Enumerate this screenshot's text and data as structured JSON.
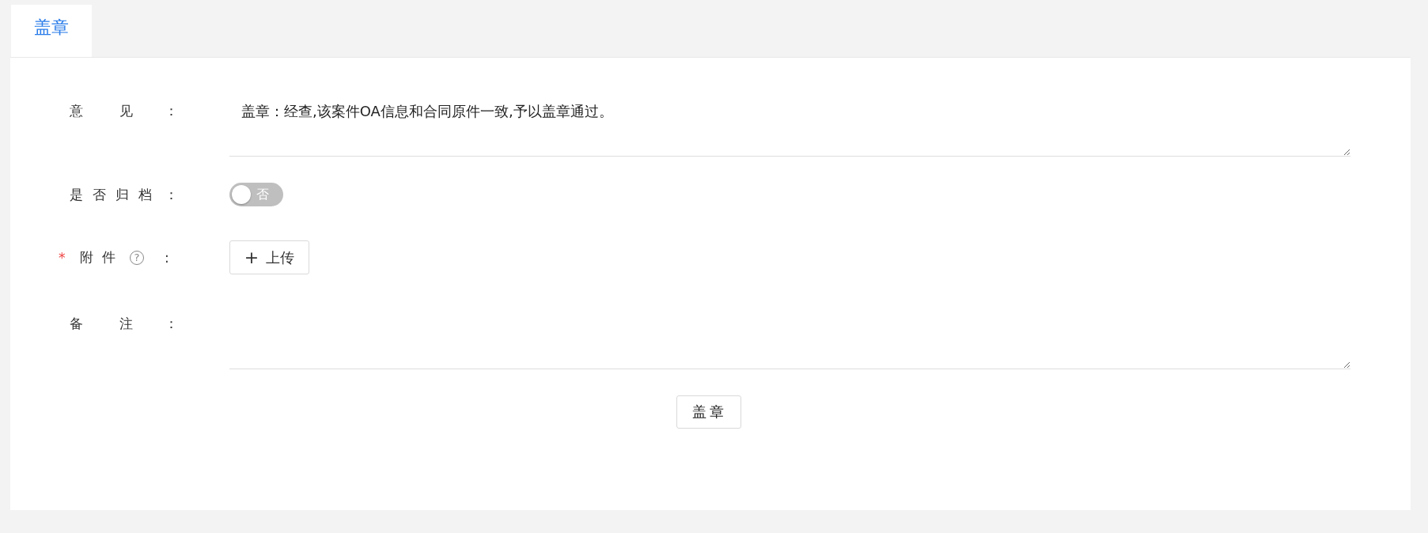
{
  "tabs": [
    {
      "label": "盖章",
      "selected": true
    }
  ],
  "form": {
    "rows": [
      {
        "kind": "textarea",
        "label": "意见",
        "colon": "：",
        "value": "盖章：经查,该案件OA信息和合同原件一致,予以盖章通过。"
      },
      {
        "kind": "switch",
        "label": "是否归档",
        "colon": "：",
        "on": false,
        "off_text": "否"
      },
      {
        "kind": "upload",
        "label": "附件",
        "colon": ":",
        "required_mark": "*",
        "help_icon": "?",
        "button": "上传",
        "button_icon": "+"
      },
      {
        "kind": "textarea",
        "label": "备注",
        "colon": "："
      }
    ],
    "submit": "盖章"
  }
}
